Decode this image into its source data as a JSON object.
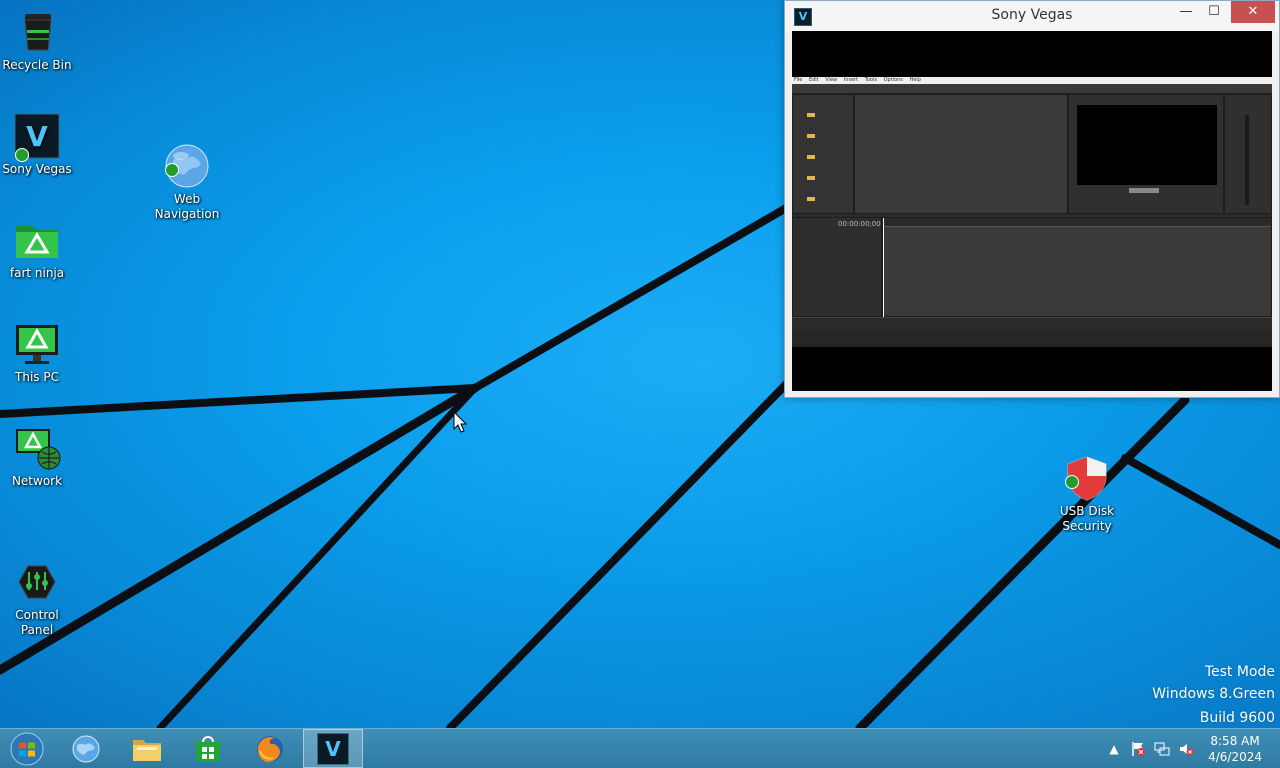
{
  "desktop": {
    "icons": [
      {
        "label": "Recycle Bin"
      },
      {
        "label": "Sony Vegas"
      },
      {
        "label": "Web\nNavigation"
      },
      {
        "label": "fart ninja"
      },
      {
        "label": "This PC"
      },
      {
        "label": "Network"
      },
      {
        "label": "Control\nPanel"
      },
      {
        "label": "USB Disk\nSecurity"
      }
    ],
    "watermark": {
      "line1": "Test Mode",
      "line2": "Windows 8.Green",
      "line3": "Build 9600"
    }
  },
  "window": {
    "title": "Sony Vegas",
    "icon_letter": "V",
    "min_glyph": "—",
    "max_glyph": "☐",
    "close_glyph": "✕",
    "timecode": "00:00:00;00",
    "menu": [
      "File",
      "Edit",
      "View",
      "Insert",
      "Tools",
      "Options",
      "Help"
    ]
  },
  "taskbar": {
    "clock_time": "8:58 AM",
    "clock_date": "4/6/2024",
    "vegas_letter": "V"
  },
  "colors": {
    "accent_green": "#35c44a",
    "taskbar": "#3786b0"
  }
}
